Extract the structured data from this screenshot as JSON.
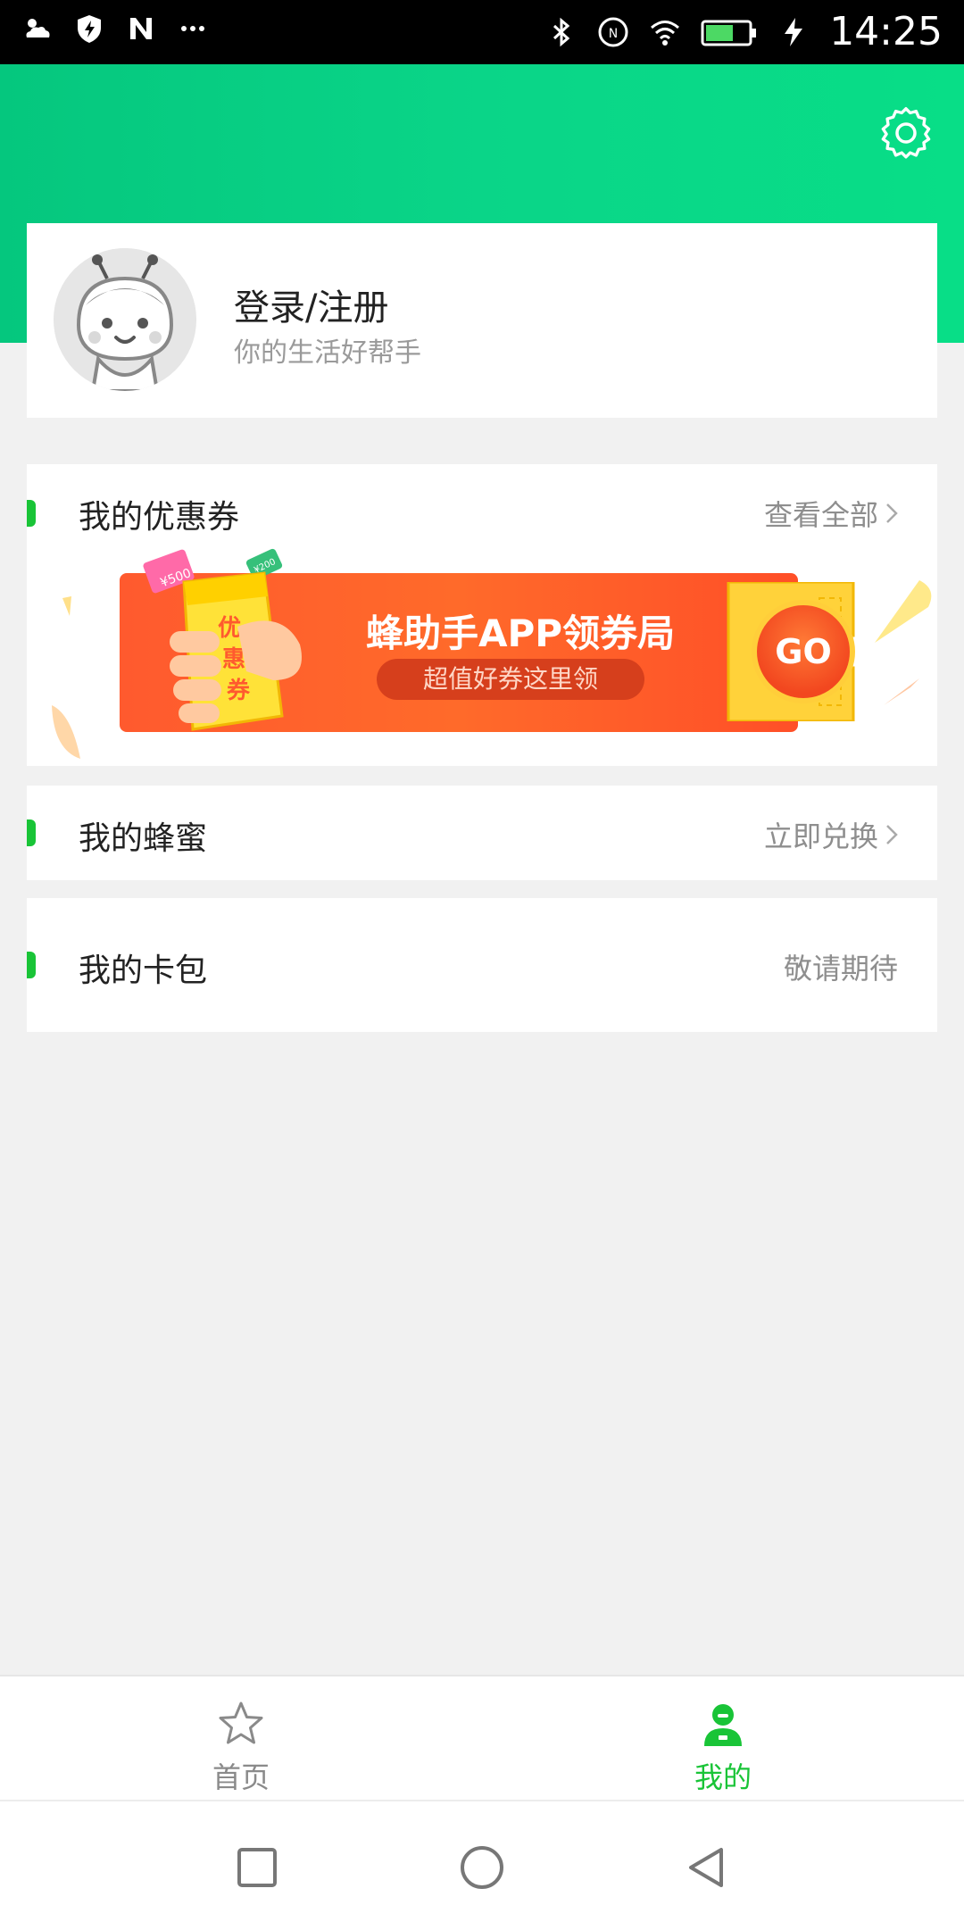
{
  "status_bar": {
    "time": "14:25",
    "left_icons": [
      "weather-icon",
      "shield-icon",
      "n-icon",
      "more-dots-icon"
    ],
    "right_icons": [
      "bluetooth-icon",
      "nfc-icon",
      "wifi-icon",
      "battery-icon",
      "charging-icon"
    ],
    "battery_level": 0.6
  },
  "colors": {
    "header_green": "#05c77e",
    "accent_green": "#19c437",
    "banner_orange": "#ff5a2e"
  },
  "profile": {
    "title": "登录/注册",
    "subtitle": "你的生活好帮手"
  },
  "coupons": {
    "title": "我的优惠券",
    "action": "查看全部",
    "banner": {
      "title": "蜂助手APP领券局",
      "subtitle": "超值好券这里领",
      "go": "GO",
      "ticket_text": "优惠券",
      "tag1": "¥500",
      "tag2": "¥200"
    }
  },
  "honey": {
    "title": "我的蜂蜜",
    "action": "立即兑换"
  },
  "card_pack": {
    "title": "我的卡包",
    "action": "敬请期待"
  },
  "bottom_nav": {
    "items": [
      {
        "label": "首页",
        "icon": "star-icon",
        "active": false
      },
      {
        "label": "我的",
        "icon": "user-icon",
        "active": true
      }
    ]
  },
  "system_nav": [
    "square-icon",
    "circle-icon",
    "back-triangle-icon"
  ]
}
